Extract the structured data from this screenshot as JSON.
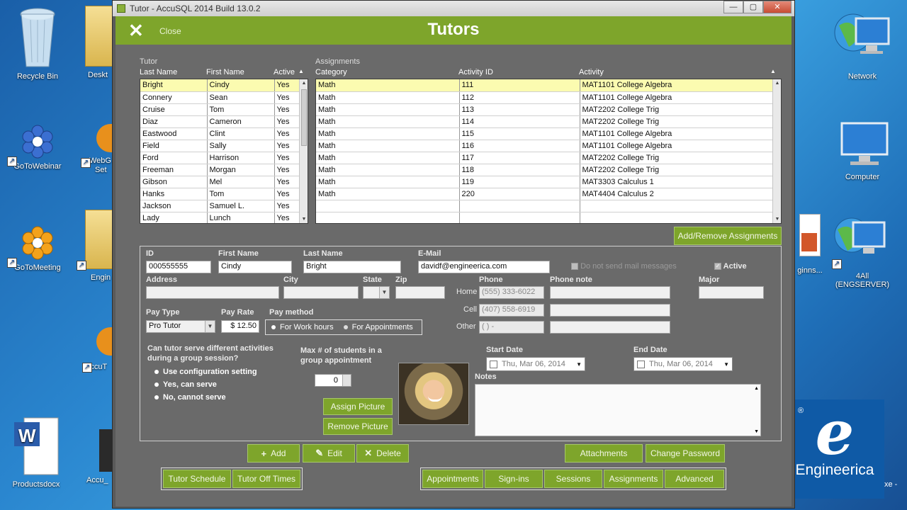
{
  "desktop": {
    "left_icons": [
      {
        "label": "Recycle Bin",
        "icon": "recycle-bin-icon"
      },
      {
        "label": "GoToWebinar",
        "icon": "gotowebinar-icon"
      },
      {
        "label": "GoToMeeting",
        "icon": "gotomeeting-icon"
      }
    ],
    "partial_icons": [
      {
        "label": "Deskt",
        "icon": "folder-icon"
      },
      {
        "label": "WebG",
        "label2": "Set",
        "icon": "web-icon"
      },
      {
        "label": "Engin",
        "icon": "folder-icon"
      },
      {
        "label": "AccuT",
        "icon": "accutrack-icon"
      },
      {
        "label": "Accu_",
        "icon": "accu-icon"
      }
    ],
    "word_icon": {
      "label": "Productsdocx",
      "icon": "word-doc-icon"
    },
    "right_icons": [
      {
        "label": "Network",
        "icon": "network-icon"
      },
      {
        "label": "Computer",
        "icon": "computer-icon"
      },
      {
        "label": "4All (ENGSERVER)",
        "icon": "network-share-icon"
      },
      {
        "label": "ginns...",
        "icon": "powerpoint-icon"
      }
    ],
    "partial_right_text": "xe -",
    "logo": {
      "brand": "Engineerica",
      "reg": "®",
      "letter": "e"
    }
  },
  "window": {
    "title": "Tutor - AccuSQL 2014 Build 13.0.2",
    "controls": [
      "—",
      "▢",
      "✕"
    ],
    "header": {
      "close_label": "Close",
      "title": "Tutors",
      "close_glyph": "✕"
    }
  },
  "tutor_list": {
    "section_label": "Tutor",
    "columns": [
      "Last Name",
      "First Name",
      "Active"
    ],
    "rows": [
      [
        "Bright",
        "Cindy",
        "Yes"
      ],
      [
        "Connery",
        "Sean",
        "Yes"
      ],
      [
        "Cruise",
        "Tom",
        "Yes"
      ],
      [
        "Diaz",
        "Cameron",
        "Yes"
      ],
      [
        "Eastwood",
        "Clint",
        "Yes"
      ],
      [
        "Field",
        "Sally",
        "Yes"
      ],
      [
        "Ford",
        "Harrison",
        "Yes"
      ],
      [
        "Freeman",
        "Morgan",
        "Yes"
      ],
      [
        "Gibson",
        "Mel",
        "Yes"
      ],
      [
        "Hanks",
        "Tom",
        "Yes"
      ],
      [
        "Jackson",
        "Samuel L.",
        "Yes"
      ],
      [
        "Lady",
        "Lunch",
        "Yes"
      ]
    ]
  },
  "assignments": {
    "section_label": "Assignments",
    "columns": [
      "Category",
      "Activity ID",
      "Activity"
    ],
    "rows": [
      [
        "Math",
        "111",
        "MAT1101 College Algebra"
      ],
      [
        "Math",
        "112",
        "MAT1101 College Algebra"
      ],
      [
        "Math",
        "113",
        "MAT2202 College Trig"
      ],
      [
        "Math",
        "114",
        "MAT2202 College Trig"
      ],
      [
        "Math",
        "115",
        "MAT1101 College Algebra"
      ],
      [
        "Math",
        "116",
        "MAT1101 College Algebra"
      ],
      [
        "Math",
        "117",
        "MAT2202 College Trig"
      ],
      [
        "Math",
        "118",
        "MAT2202 College Trig"
      ],
      [
        "Math",
        "119",
        "MAT3303 Calculus 1"
      ],
      [
        "Math",
        "220",
        "MAT4404 Calculus 2"
      ],
      [
        "",
        "",
        ""
      ],
      [
        "",
        "",
        ""
      ]
    ],
    "add_remove_label": "Add/Remove Assignments"
  },
  "form": {
    "id": {
      "label": "ID",
      "value": "000555555"
    },
    "first_name": {
      "label": "First Name",
      "value": "Cindy"
    },
    "last_name": {
      "label": "Last Name",
      "value": "Bright"
    },
    "email": {
      "label": "E-Mail",
      "value": "davidf@engineerica.com"
    },
    "no_email_label": "Do not send mail messages",
    "active_label": "Active",
    "address": {
      "label": "Address",
      "value": ""
    },
    "city": {
      "label": "City",
      "value": ""
    },
    "state": {
      "label": "State",
      "value": ""
    },
    "zip": {
      "label": "Zip",
      "value": ""
    },
    "phone_label": "Phone",
    "phone_note_label": "Phone note",
    "major": {
      "label": "Major",
      "value": ""
    },
    "phones": [
      {
        "label": "Home",
        "value": "(555) 333-6022",
        "note": ""
      },
      {
        "label": "Cell",
        "value": "(407) 558-6919",
        "note": ""
      },
      {
        "label": "Other",
        "value": "(   )   -",
        "note": ""
      }
    ],
    "pay_type": {
      "label": "Pay Type",
      "value": "Pro Tutor"
    },
    "pay_rate": {
      "label": "Pay Rate",
      "value": "$ 12.50"
    },
    "pay_method": {
      "label": "Pay method",
      "options": [
        "For Work hours",
        "For Appointments"
      ]
    },
    "group_question": {
      "line1": "Can tutor serve different activities",
      "line2": "during a group session?"
    },
    "group_options": [
      "Use configuration setting",
      "Yes, can serve",
      "No, cannot serve"
    ],
    "max_students": {
      "line1": "Max # of students in a",
      "line2": "group appointment",
      "value": "0"
    },
    "start_date": {
      "label": "Start Date",
      "value": "Thu, Mar 06, 2014"
    },
    "end_date": {
      "label": "End Date",
      "value": "Thu, Mar 06, 2014"
    },
    "notes_label": "Notes",
    "assign_picture": "Assign Picture",
    "remove_picture": "Remove Picture"
  },
  "actions": {
    "add": "Add",
    "edit": "Edit",
    "delete": "Delete",
    "attachments": "Attachments",
    "change_password": "Change Password",
    "tutor_schedule": "Tutor Schedule",
    "tutor_off_times": "Tutor Off Times",
    "appointments": "Appointments",
    "sign_ins": "Sign-ins",
    "sessions": "Sessions",
    "assignments": "Assignments",
    "advanced": "Advanced"
  },
  "colors": {
    "accent_green": "#7ea52b",
    "window_bg": "#6a6a6a",
    "selected_row": "#fbfbb0",
    "logo_blue": "#0f5aa6"
  }
}
